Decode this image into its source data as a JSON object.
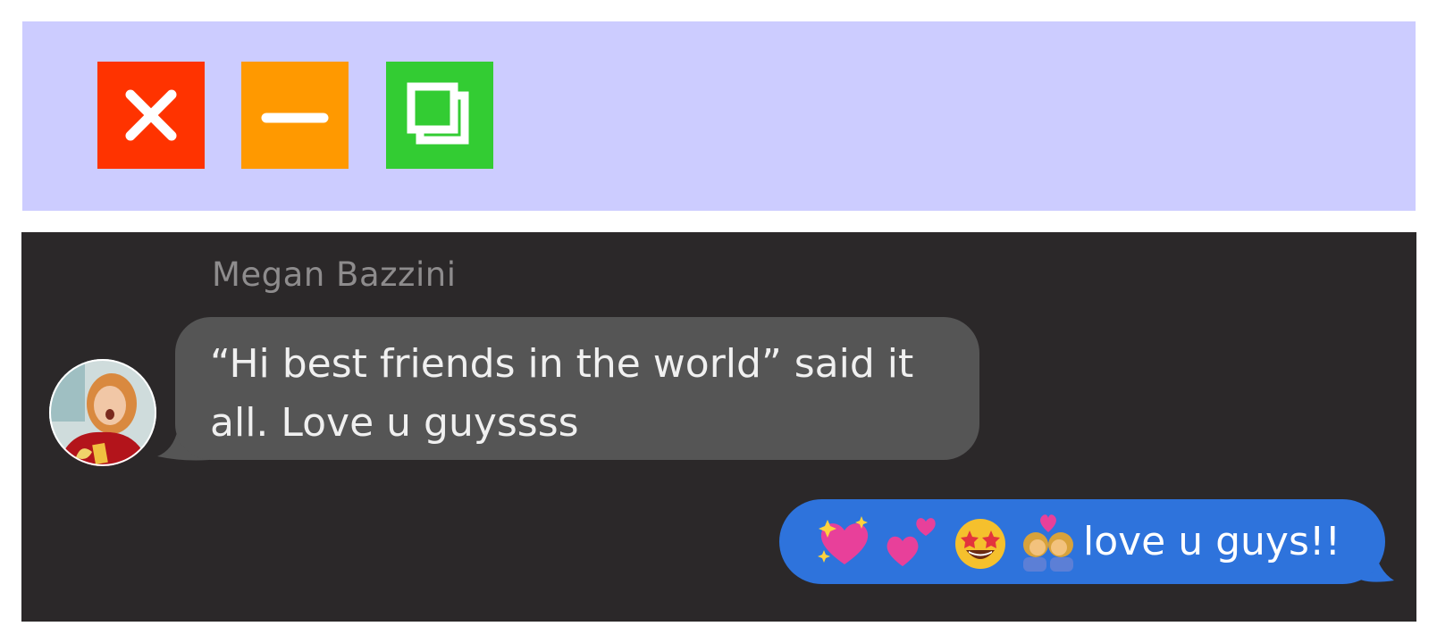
{
  "window_controls": {
    "close": {
      "icon": "close-icon",
      "color": "#ff3300"
    },
    "minimize": {
      "icon": "minimize-icon",
      "color": "#ff9900"
    },
    "maximize": {
      "icon": "maximize-icon",
      "color": "#33cc33"
    },
    "titlebar_color": "#ccccff"
  },
  "conversation": {
    "background": "#2b2829",
    "messages": [
      {
        "direction": "incoming",
        "sender": "Megan Bazzini",
        "avatar": "avatar-photo",
        "text": "“Hi best friends in the world” said it all. Love u guyssss",
        "bubble_color": "#555555"
      },
      {
        "direction": "outgoing",
        "emojis": [
          "sparkling-heart-emoji",
          "two-hearts-emoji",
          "star-struck-emoji",
          "kiss-women-emoji"
        ],
        "text": "love u guys!!",
        "bubble_color": "#2e73dc"
      }
    ]
  }
}
